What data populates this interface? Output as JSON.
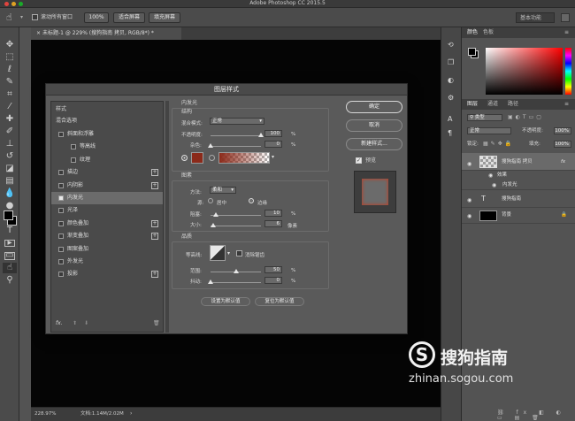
{
  "app": {
    "title": "Adobe Photoshop CC 2015.5"
  },
  "optbar": {
    "scroll_all": "滚动所有窗口",
    "zoom_100": "100%",
    "fit_screen": "适合屏幕",
    "fill_screen": "填充屏幕",
    "workspace": "基本功能"
  },
  "doc": {
    "tab": "未标题-1 @ 229% (搜狗指南 拷贝, RGB/8*) *",
    "zoom": "228.97%",
    "docsize": "文档:1.14M/2.02M"
  },
  "dialog": {
    "title": "图层样式",
    "styles_header": "样式",
    "blend_header": "混合选项",
    "style_items": [
      {
        "label": "斜面和浮雕",
        "checked": false,
        "plus": false
      },
      {
        "label": "等高线",
        "checked": false,
        "plus": false
      },
      {
        "label": "纹理",
        "checked": false,
        "plus": false
      },
      {
        "label": "描边",
        "checked": false,
        "plus": true
      },
      {
        "label": "内阴影",
        "checked": false,
        "plus": true
      },
      {
        "label": "内发光",
        "checked": true,
        "plus": false
      },
      {
        "label": "光泽",
        "checked": false,
        "plus": false
      },
      {
        "label": "颜色叠加",
        "checked": false,
        "plus": true
      },
      {
        "label": "渐变叠加",
        "checked": false,
        "plus": true
      },
      {
        "label": "图案叠加",
        "checked": false,
        "plus": false
      },
      {
        "label": "外发光",
        "checked": false,
        "plus": false
      },
      {
        "label": "投影",
        "checked": false,
        "plus": true
      }
    ],
    "fx_label": "fx.",
    "section_title": "内发光",
    "structure": {
      "title": "结构",
      "blend_mode_label": "混合模式:",
      "blend_mode_value": "正常",
      "opacity_label": "不透明度:",
      "opacity_value": "100",
      "opacity_unit": "%",
      "opacity_level": 1.0,
      "noise_label": "杂色:",
      "noise_value": "0",
      "noise_unit": "%",
      "noise_level": 0.0,
      "glow_color": "#8b2a1a"
    },
    "elements": {
      "title": "图素",
      "method_label": "方法:",
      "method_value": "柔和",
      "source_label": "源:",
      "source_center": "居中",
      "source_edge": "边缘",
      "choke_label": "阻塞:",
      "choke_value": "10",
      "choke_unit": "%",
      "choke_level": 0.1,
      "size_label": "大小:",
      "size_value": "6",
      "size_unit": "像素",
      "size_level": 0.06
    },
    "quality": {
      "title": "品质",
      "contour_label": "等高线:",
      "antialias_label": "消除锯齿",
      "range_label": "范围:",
      "range_value": "50",
      "range_unit": "%",
      "range_level": 0.5,
      "jitter_label": "抖动:",
      "jitter_value": "0",
      "jitter_unit": "%",
      "jitter_level": 0.0
    },
    "set_default": "设置为默认值",
    "reset_default": "复位为默认值",
    "ok": "确定",
    "cancel": "取消",
    "new_style": "新建样式...",
    "preview": "预览"
  },
  "panels": {
    "color_tabs": [
      "颜色",
      "色板"
    ],
    "layer_tabs": [
      "图层",
      "通道",
      "路径"
    ],
    "kind_filter": "类型",
    "blend": "正常",
    "opacity_label": "不透明度:",
    "opacity_value": "100%",
    "lock_label": "锁定:",
    "fill_label": "填充:",
    "fill_value": "100%",
    "layers": [
      {
        "name": "搜狗指南 拷贝",
        "type": "copy",
        "fx": "fx"
      },
      {
        "name": "效果",
        "type": "effects"
      },
      {
        "name": "内发光",
        "type": "effect"
      },
      {
        "name": "搜狗指南",
        "type": "text",
        "thumb": "T"
      },
      {
        "name": "背景",
        "type": "background"
      }
    ]
  },
  "watermark": {
    "brand": "搜狗指南",
    "url": "zhinan.sogou.com"
  }
}
